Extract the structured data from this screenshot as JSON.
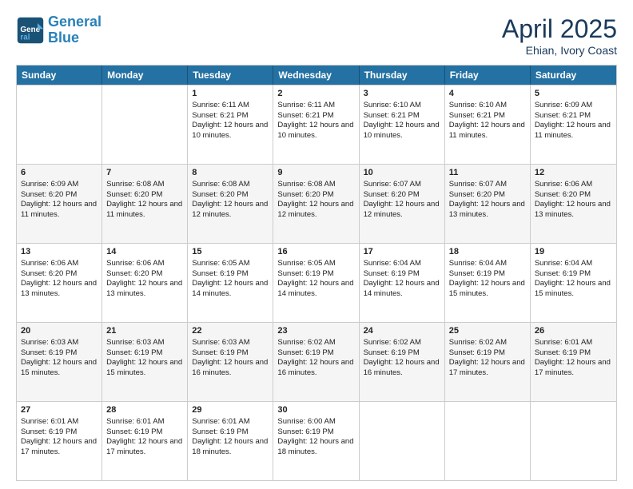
{
  "header": {
    "logo_line1": "General",
    "logo_line2": "Blue",
    "month_title": "April 2025",
    "subtitle": "Ehian, Ivory Coast"
  },
  "days_of_week": [
    "Sunday",
    "Monday",
    "Tuesday",
    "Wednesday",
    "Thursday",
    "Friday",
    "Saturday"
  ],
  "weeks": [
    [
      {
        "day": "",
        "sunrise": "",
        "sunset": "",
        "daylight": ""
      },
      {
        "day": "",
        "sunrise": "",
        "sunset": "",
        "daylight": ""
      },
      {
        "day": "1",
        "sunrise": "Sunrise: 6:11 AM",
        "sunset": "Sunset: 6:21 PM",
        "daylight": "Daylight: 12 hours and 10 minutes."
      },
      {
        "day": "2",
        "sunrise": "Sunrise: 6:11 AM",
        "sunset": "Sunset: 6:21 PM",
        "daylight": "Daylight: 12 hours and 10 minutes."
      },
      {
        "day": "3",
        "sunrise": "Sunrise: 6:10 AM",
        "sunset": "Sunset: 6:21 PM",
        "daylight": "Daylight: 12 hours and 10 minutes."
      },
      {
        "day": "4",
        "sunrise": "Sunrise: 6:10 AM",
        "sunset": "Sunset: 6:21 PM",
        "daylight": "Daylight: 12 hours and 11 minutes."
      },
      {
        "day": "5",
        "sunrise": "Sunrise: 6:09 AM",
        "sunset": "Sunset: 6:21 PM",
        "daylight": "Daylight: 12 hours and 11 minutes."
      }
    ],
    [
      {
        "day": "6",
        "sunrise": "Sunrise: 6:09 AM",
        "sunset": "Sunset: 6:20 PM",
        "daylight": "Daylight: 12 hours and 11 minutes."
      },
      {
        "day": "7",
        "sunrise": "Sunrise: 6:08 AM",
        "sunset": "Sunset: 6:20 PM",
        "daylight": "Daylight: 12 hours and 11 minutes."
      },
      {
        "day": "8",
        "sunrise": "Sunrise: 6:08 AM",
        "sunset": "Sunset: 6:20 PM",
        "daylight": "Daylight: 12 hours and 12 minutes."
      },
      {
        "day": "9",
        "sunrise": "Sunrise: 6:08 AM",
        "sunset": "Sunset: 6:20 PM",
        "daylight": "Daylight: 12 hours and 12 minutes."
      },
      {
        "day": "10",
        "sunrise": "Sunrise: 6:07 AM",
        "sunset": "Sunset: 6:20 PM",
        "daylight": "Daylight: 12 hours and 12 minutes."
      },
      {
        "day": "11",
        "sunrise": "Sunrise: 6:07 AM",
        "sunset": "Sunset: 6:20 PM",
        "daylight": "Daylight: 12 hours and 13 minutes."
      },
      {
        "day": "12",
        "sunrise": "Sunrise: 6:06 AM",
        "sunset": "Sunset: 6:20 PM",
        "daylight": "Daylight: 12 hours and 13 minutes."
      }
    ],
    [
      {
        "day": "13",
        "sunrise": "Sunrise: 6:06 AM",
        "sunset": "Sunset: 6:20 PM",
        "daylight": "Daylight: 12 hours and 13 minutes."
      },
      {
        "day": "14",
        "sunrise": "Sunrise: 6:06 AM",
        "sunset": "Sunset: 6:20 PM",
        "daylight": "Daylight: 12 hours and 13 minutes."
      },
      {
        "day": "15",
        "sunrise": "Sunrise: 6:05 AM",
        "sunset": "Sunset: 6:19 PM",
        "daylight": "Daylight: 12 hours and 14 minutes."
      },
      {
        "day": "16",
        "sunrise": "Sunrise: 6:05 AM",
        "sunset": "Sunset: 6:19 PM",
        "daylight": "Daylight: 12 hours and 14 minutes."
      },
      {
        "day": "17",
        "sunrise": "Sunrise: 6:04 AM",
        "sunset": "Sunset: 6:19 PM",
        "daylight": "Daylight: 12 hours and 14 minutes."
      },
      {
        "day": "18",
        "sunrise": "Sunrise: 6:04 AM",
        "sunset": "Sunset: 6:19 PM",
        "daylight": "Daylight: 12 hours and 15 minutes."
      },
      {
        "day": "19",
        "sunrise": "Sunrise: 6:04 AM",
        "sunset": "Sunset: 6:19 PM",
        "daylight": "Daylight: 12 hours and 15 minutes."
      }
    ],
    [
      {
        "day": "20",
        "sunrise": "Sunrise: 6:03 AM",
        "sunset": "Sunset: 6:19 PM",
        "daylight": "Daylight: 12 hours and 15 minutes."
      },
      {
        "day": "21",
        "sunrise": "Sunrise: 6:03 AM",
        "sunset": "Sunset: 6:19 PM",
        "daylight": "Daylight: 12 hours and 15 minutes."
      },
      {
        "day": "22",
        "sunrise": "Sunrise: 6:03 AM",
        "sunset": "Sunset: 6:19 PM",
        "daylight": "Daylight: 12 hours and 16 minutes."
      },
      {
        "day": "23",
        "sunrise": "Sunrise: 6:02 AM",
        "sunset": "Sunset: 6:19 PM",
        "daylight": "Daylight: 12 hours and 16 minutes."
      },
      {
        "day": "24",
        "sunrise": "Sunrise: 6:02 AM",
        "sunset": "Sunset: 6:19 PM",
        "daylight": "Daylight: 12 hours and 16 minutes."
      },
      {
        "day": "25",
        "sunrise": "Sunrise: 6:02 AM",
        "sunset": "Sunset: 6:19 PM",
        "daylight": "Daylight: 12 hours and 17 minutes."
      },
      {
        "day": "26",
        "sunrise": "Sunrise: 6:01 AM",
        "sunset": "Sunset: 6:19 PM",
        "daylight": "Daylight: 12 hours and 17 minutes."
      }
    ],
    [
      {
        "day": "27",
        "sunrise": "Sunrise: 6:01 AM",
        "sunset": "Sunset: 6:19 PM",
        "daylight": "Daylight: 12 hours and 17 minutes."
      },
      {
        "day": "28",
        "sunrise": "Sunrise: 6:01 AM",
        "sunset": "Sunset: 6:19 PM",
        "daylight": "Daylight: 12 hours and 17 minutes."
      },
      {
        "day": "29",
        "sunrise": "Sunrise: 6:01 AM",
        "sunset": "Sunset: 6:19 PM",
        "daylight": "Daylight: 12 hours and 18 minutes."
      },
      {
        "day": "30",
        "sunrise": "Sunrise: 6:00 AM",
        "sunset": "Sunset: 6:19 PM",
        "daylight": "Daylight: 12 hours and 18 minutes."
      },
      {
        "day": "",
        "sunrise": "",
        "sunset": "",
        "daylight": ""
      },
      {
        "day": "",
        "sunrise": "",
        "sunset": "",
        "daylight": ""
      },
      {
        "day": "",
        "sunrise": "",
        "sunset": "",
        "daylight": ""
      }
    ]
  ]
}
